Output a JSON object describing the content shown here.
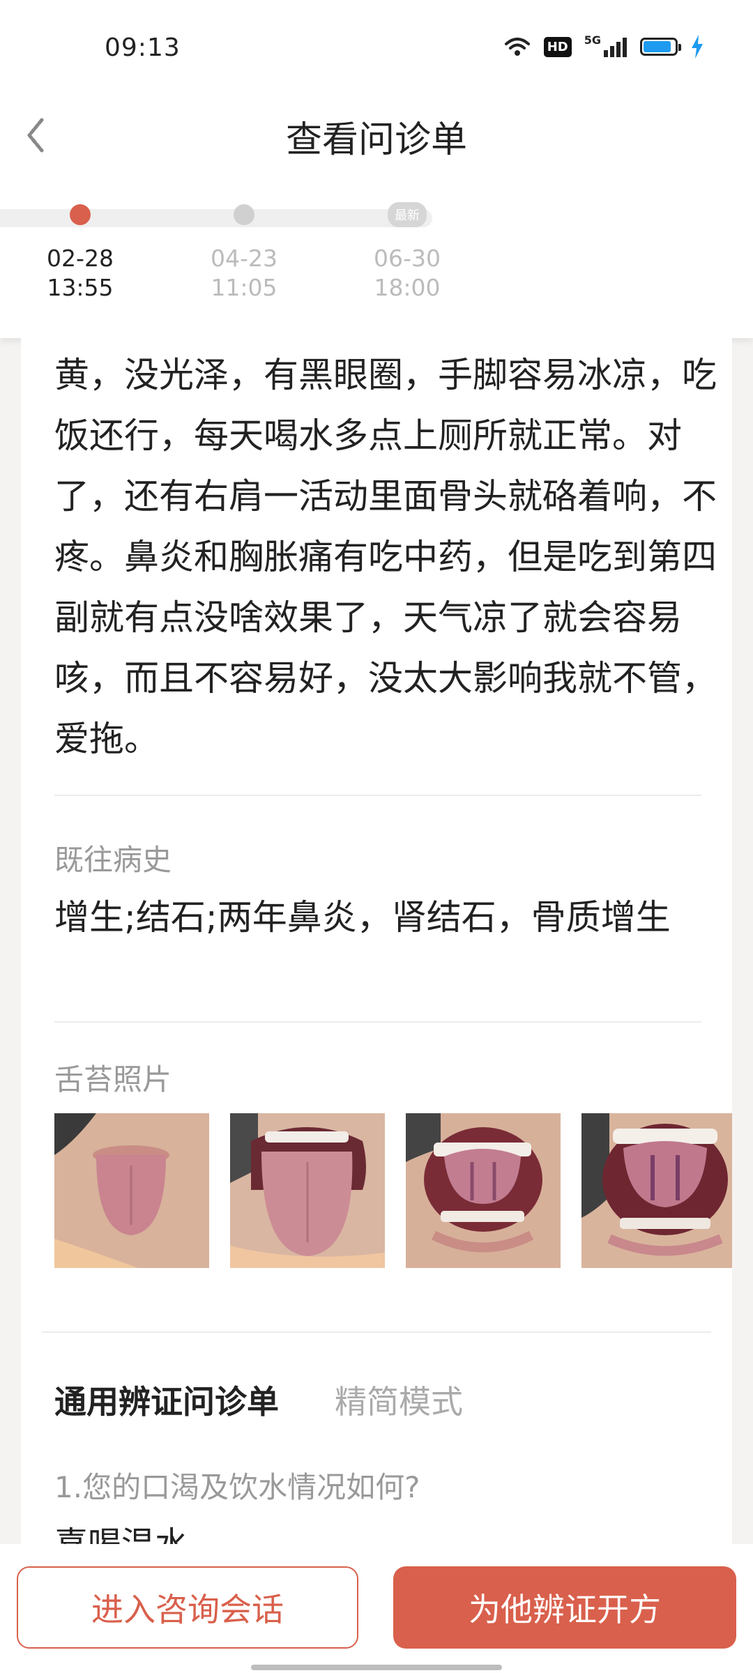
{
  "status_bar": {
    "time": "09:13",
    "hd_badge": "HD",
    "network": "5G",
    "battery_color": "#1e9bf0"
  },
  "header": {
    "title": "查看问诊单",
    "back_icon": "back-icon"
  },
  "timeline": {
    "items": [
      {
        "date": "02-28",
        "time": "13:55",
        "active": true
      },
      {
        "date": "04-23",
        "time": "11:05",
        "active": false
      },
      {
        "date": "06-30",
        "time": "18:00",
        "active": false,
        "badge": "最新"
      }
    ]
  },
  "complaint_text": "黄，没光泽，有黑眼圈，手脚容易冰凉，吃饭还行，每天喝水多点上厕所就正常。对了，还有右肩一活动里面骨头就硌着响，不疼。鼻炎和胸胀痛有吃中药，但是吃到第四副就有点没啥效果了，天气凉了就会容易咳，而且不容易好，没太大影响我就不管，爱拖。",
  "medical_history": {
    "label": "既往病史",
    "value": "增生;结石;两年鼻炎，肾结石，骨质增生"
  },
  "tongue_photos": {
    "label": "舌苔照片",
    "count": 4
  },
  "mode_tabs": {
    "active": "通用辨证问诊单",
    "inactive": "精简模式"
  },
  "questions": [
    {
      "question": "1.您的口渴及饮水情况如何?",
      "answer": "喜喝温水"
    }
  ],
  "bottom_bar": {
    "consult_button": "进入咨询会话",
    "prescribe_button": "为他辨证开方"
  },
  "colors": {
    "accent": "#d9604c",
    "background": "#f4f3f1"
  }
}
